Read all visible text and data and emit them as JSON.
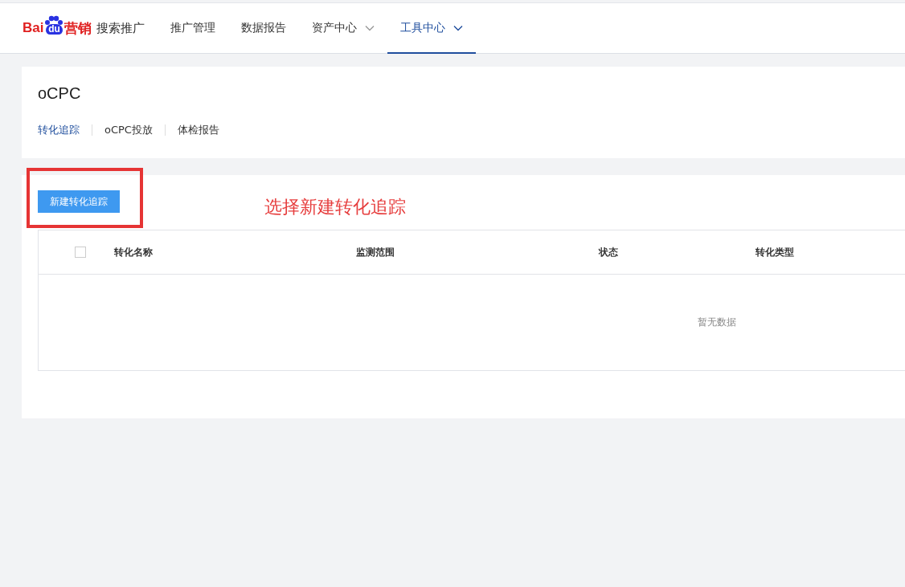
{
  "header": {
    "logo": {
      "left": "Bai",
      "paw": "du",
      "right": "营销"
    },
    "product": "搜索推广",
    "nav": [
      {
        "label": "推广管理",
        "dropdown": false,
        "selected": false
      },
      {
        "label": "数据报告",
        "dropdown": false,
        "selected": false
      },
      {
        "label": "资产中心",
        "dropdown": true,
        "selected": false
      },
      {
        "label": "工具中心",
        "dropdown": true,
        "selected": true
      }
    ]
  },
  "page_title": "oCPC",
  "tabs": [
    {
      "label": "转化追踪",
      "selected": true
    },
    {
      "label": "oCPC投放",
      "selected": false
    },
    {
      "label": "体检报告",
      "selected": false
    }
  ],
  "new_button": "新建转化追踪",
  "annotation": {
    "text": "选择新建转化追踪"
  },
  "table": {
    "select_all": {
      "checked": false
    },
    "columns": [
      "转化名称",
      "监测范围",
      "状态",
      "转化类型"
    ],
    "empty_text": "暂无数据"
  }
}
